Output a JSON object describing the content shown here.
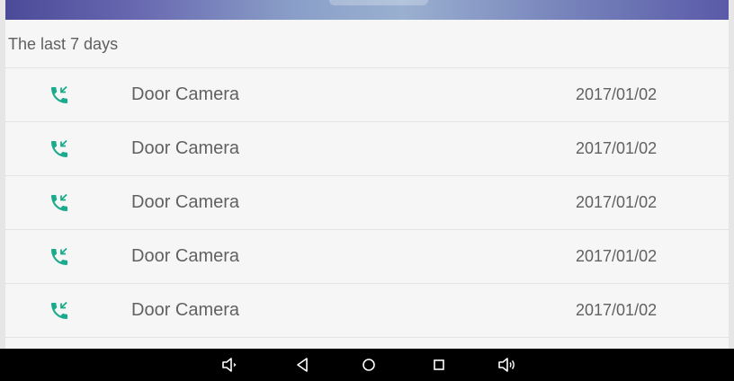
{
  "history": {
    "section_title": "The last 7 days",
    "entries": [
      {
        "name": "Door Camera",
        "date": "2017/01/02",
        "type": "incoming-call"
      },
      {
        "name": "Door Camera",
        "date": "2017/01/02",
        "type": "incoming-call"
      },
      {
        "name": "Door Camera",
        "date": "2017/01/02",
        "type": "incoming-call"
      },
      {
        "name": "Door Camera",
        "date": "2017/01/02",
        "type": "incoming-call"
      },
      {
        "name": "Door Camera",
        "date": "2017/01/02",
        "type": "incoming-call"
      }
    ]
  },
  "icons": {
    "entry_icon": "incoming-call-icon",
    "entry_icon_color": "#1aaa8c"
  },
  "nav_bar": {
    "buttons": [
      "volume-down-icon",
      "back-icon",
      "home-icon",
      "recents-icon",
      "volume-up-icon"
    ],
    "color": "#ffffff"
  }
}
